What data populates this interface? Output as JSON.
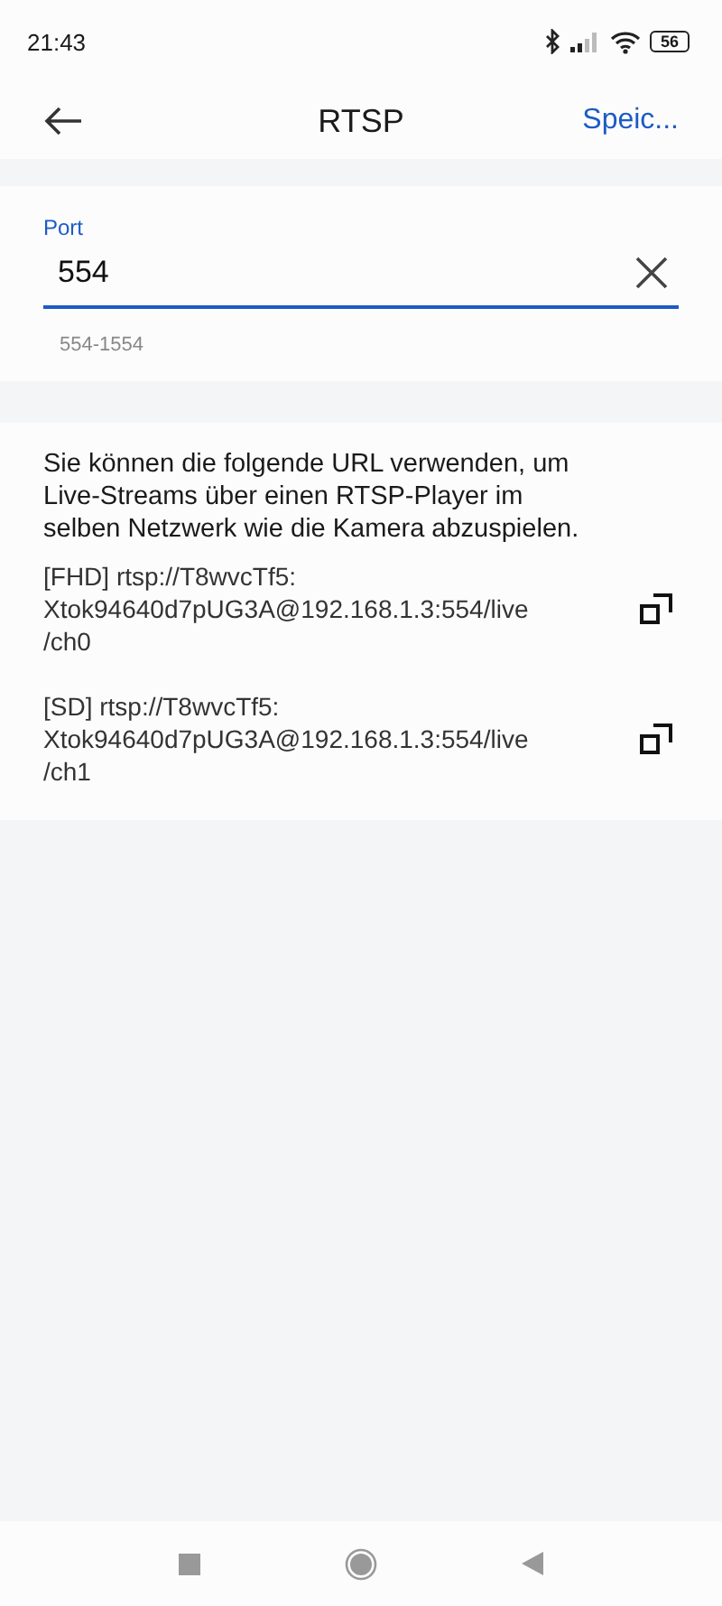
{
  "status_bar": {
    "time": "21:43",
    "battery": "56"
  },
  "header": {
    "title": "RTSP",
    "action": "Speic..."
  },
  "port": {
    "label": "Port",
    "value": "554",
    "hint": "554-1554"
  },
  "info": {
    "text": "Sie können die folgende URL verwenden, um Live-Streams über einen RTSP-Player im selben Netzwerk wie die Kamera abzuspielen.",
    "urls": [
      {
        "lines": [
          "[FHD] rtsp://T8wvcTf5:",
          "Xtok94640d7pUG3A@192.168.1.3:554/live",
          "/ch0"
        ]
      },
      {
        "lines": [
          "[SD] rtsp://T8wvcTf5:",
          "Xtok94640d7pUG3A@192.168.1.3:554/live",
          "/ch1"
        ]
      }
    ]
  }
}
